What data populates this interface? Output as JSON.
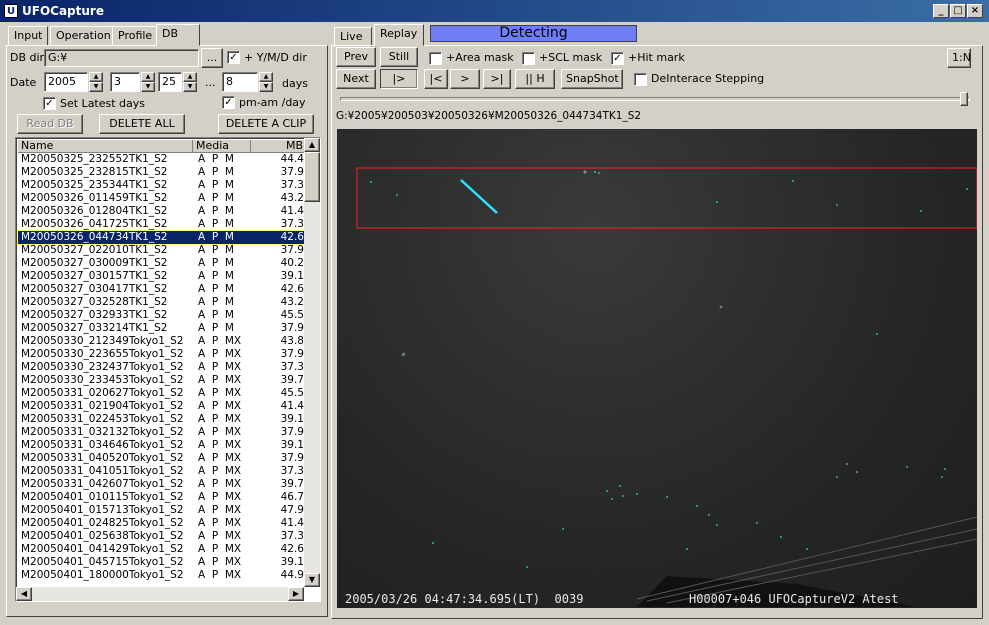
{
  "window": {
    "title": "UFOCapture",
    "minimize": "_",
    "maximize": "□",
    "close": "×"
  },
  "left": {
    "tabs": [
      "Input",
      "Operation",
      "Profile",
      "DB"
    ],
    "db_dir_label": "DB dir",
    "db_dir_value": "G:¥",
    "browse_label": "...",
    "ymd_label": "+ Y/M/D dir",
    "ymd_checked": true,
    "date_label": "Date",
    "year": "2005",
    "month": "3",
    "day": "25",
    "range_sep": "...",
    "days": "8",
    "days_label": "days",
    "set_latest_label": "Set Latest days",
    "set_latest_checked": true,
    "pm_am_label": "pm-am /day",
    "pm_am_checked": true,
    "read_db": "Read DB",
    "delete_all": "DELETE ALL",
    "delete_clip": "DELETE A CLIP",
    "columns": [
      "Name",
      "Media",
      "MB"
    ],
    "rows": [
      [
        "M20050325_232552TK1_S2",
        "A P M",
        "44.4"
      ],
      [
        "M20050325_232815TK1_S2",
        "A P M",
        "37.9"
      ],
      [
        "M20050325_235344TK1_S2",
        "A P M",
        "37.3"
      ],
      [
        "M20050326_011459TK1_S2",
        "A P M",
        "43.2"
      ],
      [
        "M20050326_012804TK1_S2",
        "A P M",
        "41.4"
      ],
      [
        "M20050326_041725TK1_S2",
        "A P M",
        "37.3"
      ],
      [
        "M20050326_044734TK1_S2",
        "A P M",
        "42.6"
      ],
      [
        "M20050327_022010TK1_S2",
        "A P M",
        "37.9"
      ],
      [
        "M20050327_030009TK1_S2",
        "A P M",
        "40.2"
      ],
      [
        "M20050327_030157TK1_S2",
        "A P M",
        "39.1"
      ],
      [
        "M20050327_030417TK1_S2",
        "A P M",
        "42.6"
      ],
      [
        "M20050327_032528TK1_S2",
        "A P M",
        "43.2"
      ],
      [
        "M20050327_032933TK1_S2",
        "A P M",
        "45.5"
      ],
      [
        "M20050327_033214TK1_S2",
        "A P M",
        "37.9"
      ],
      [
        "M20050330_212349Tokyo1_S2",
        "A P MX",
        "43.8"
      ],
      [
        "M20050330_223655Tokyo1_S2",
        "A P MX",
        "37.9"
      ],
      [
        "M20050330_232437Tokyo1_S2",
        "A P MX",
        "37.3"
      ],
      [
        "M20050330_233453Tokyo1_S2",
        "A P MX",
        "39.7"
      ],
      [
        "M20050331_020627Tokyo1_S2",
        "A P MX",
        "45.5"
      ],
      [
        "M20050331_021904Tokyo1_S2",
        "A P MX",
        "41.4"
      ],
      [
        "M20050331_022453Tokyo1_S2",
        "A P MX",
        "39.1"
      ],
      [
        "M20050331_032132Tokyo1_S2",
        "A P MX",
        "37.9"
      ],
      [
        "M20050331_034646Tokyo1_S2",
        "A P MX",
        "39.1"
      ],
      [
        "M20050331_040520Tokyo1_S2",
        "A P MX",
        "37.9"
      ],
      [
        "M20050331_041051Tokyo1_S2",
        "A P MX",
        "37.3"
      ],
      [
        "M20050331_042607Tokyo1_S2",
        "A P MX",
        "39.7"
      ],
      [
        "M20050401_010115Tokyo1_S2",
        "A P MX",
        "46.7"
      ],
      [
        "M20050401_015713Tokyo1_S2",
        "A P MX",
        "47.9"
      ],
      [
        "M20050401_024825Tokyo1_S2",
        "A P MX",
        "41.4"
      ],
      [
        "M20050401_025638Tokyo1_S2",
        "A P MX",
        "37.3"
      ],
      [
        "M20050401_041429Tokyo1_S2",
        "A P MX",
        "42.6"
      ],
      [
        "M20050401_045715Tokyo1_S2",
        "A P MX",
        "39.1"
      ],
      [
        "M20050401_180000Tokyo1_S2",
        "A P MX",
        "44.9"
      ]
    ],
    "selected_row": 6
  },
  "right": {
    "tabs": [
      "Live",
      "Replay"
    ],
    "status": "Detecting",
    "prev": "Prev",
    "still": "Still",
    "next": "Next",
    "play": "|>",
    "to_start": "|<",
    "step": ">",
    "to_end": ">|",
    "half": "|| H",
    "snapshot": "SnapShot",
    "area_mask": "+Area mask",
    "area_mask_checked": false,
    "scl_mask": "+SCL mask",
    "scl_mask_checked": false,
    "hit_mark": "+Hit mark",
    "hit_mark_checked": true,
    "deinterlace": "DeInterace Stepping",
    "deinterlace_checked": false,
    "ratio": "1:N",
    "clip_path": "G:¥2005¥200503¥20050326¥M20050326_044734TK1_S2",
    "progress": 1.0,
    "osd_left": "2005/03/26 04:47:34.695(LT)  0039",
    "osd_right": "H00007+046 UFOCaptureV2 Atest"
  },
  "colors": {
    "title_bar": "#0a246a",
    "status_bar": "#6f7ef5",
    "hit_box": "#ff2020",
    "meteor": "#30e0ff",
    "selection": "#0a246a"
  },
  "icons": {
    "app": "ufo-app-icon",
    "check": "check-icon"
  }
}
